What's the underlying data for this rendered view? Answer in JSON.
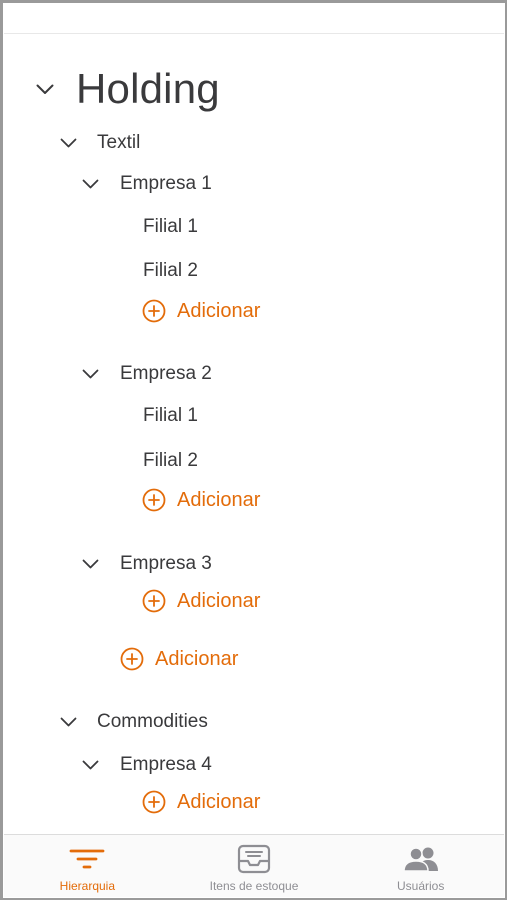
{
  "colors": {
    "accent": "#e36c0a",
    "text": "#3a3a3c",
    "inactive": "#8e8e93"
  },
  "tree": {
    "root": {
      "label": "Holding",
      "icon": "chevron-down-icon"
    },
    "groups": [
      {
        "label": "Textil",
        "companies": [
          {
            "label": "Empresa 1",
            "branches": [
              "Filial 1",
              "Filial 2"
            ],
            "add_label": "Adicionar"
          },
          {
            "label": "Empresa 2",
            "branches": [
              "Filial 1",
              "Filial 2"
            ],
            "add_label": "Adicionar"
          },
          {
            "label": "Empresa 3",
            "branches": [],
            "add_label": "Adicionar"
          }
        ],
        "add_label": "Adicionar"
      },
      {
        "label": "Commodities",
        "companies": [
          {
            "label": "Empresa 4",
            "branches": [],
            "add_label": "Adicionar"
          }
        ]
      }
    ]
  },
  "tabbar": {
    "tabs": [
      {
        "label": "Hierarquia",
        "icon": "filter-lines-icon",
        "active": true
      },
      {
        "label": "Itens de estoque",
        "icon": "inbox-tray-icon",
        "active": false
      },
      {
        "label": "Usuários",
        "icon": "users-icon",
        "active": false
      }
    ]
  }
}
